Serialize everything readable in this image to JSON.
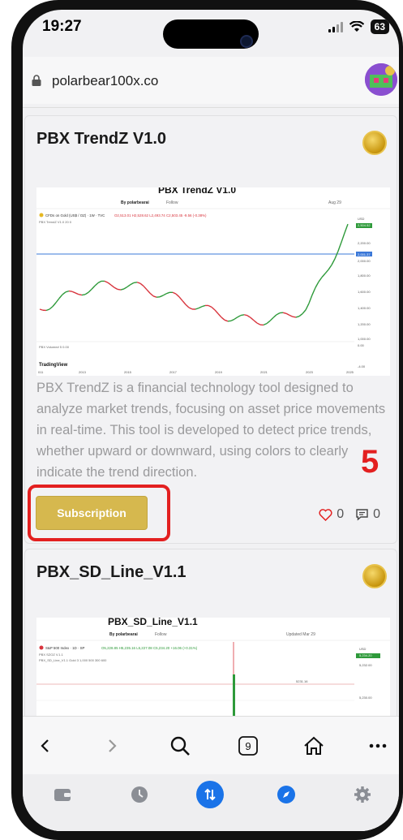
{
  "status_bar": {
    "time": "19:27",
    "battery": "63"
  },
  "browser": {
    "url": "polarbear100x.co",
    "tab_count": "9"
  },
  "cards": [
    {
      "title": "PBX TrendZ V1.0",
      "chart_title": "PBX TrendZ V1.0",
      "chart_byline": "By polarbearai",
      "chart_follow": "Follow",
      "chart_date": "Aug 29",
      "chart_symbol": "CFDs on Gold (US$ / OZ) · 1W · TVC",
      "chart_ohlc": "O2,513.01 H2,528.62 L2,493.74 C2,503.45 -9.56 (-0.38%)",
      "chart_indicator": "PBX TrendZ V1.0 20 0",
      "chart_volume": "PBX Volume# 5 0.00",
      "chart_brand": "TradingView",
      "chart_price_labels": [
        "USD",
        "2,504.52",
        "2,200.00",
        "2,001.37",
        "2,000.00",
        "1,800.00",
        "1,600.00",
        "1,400.00",
        "1,200.00",
        "1,000.00",
        "0.00",
        "-4.00"
      ],
      "chart_years": [
        "011",
        "2013",
        "2015",
        "2017",
        "2019",
        "2021",
        "2023",
        "2025"
      ],
      "description": "PBX TrendZ is a financial technology tool designed to analyze market trends, focusing on asset price movements in real-time. This tool is developed to detect price trends, whether upward or downward, using colors to clearly indicate the trend direction.",
      "button_label": "Subscription",
      "likes": "0",
      "comments": "0",
      "annotation_number": "5"
    },
    {
      "title": "PBX_SD_Line_V1.1",
      "chart_title": "PBX_SD_Line_V1.1",
      "chart_byline": "By polarbearai",
      "chart_follow": "Follow",
      "chart_date": "Updated Mar 29",
      "chart_symbol": "S&P 500 Index · 1D · SP",
      "chart_ohlc": "O5,228.85 H5,235.16 L5,227.08 C5,234.20 +16.06 (+0.31%)",
      "chart_indicator": "PBX SZOZ V.1.1",
      "chart_indicator2": "PBX_SD_Line_V1.1 Gold 3 1,000 500 300 600",
      "chart_price_labels": [
        "USD",
        "5,234.20",
        "5,232.00",
        "5231.16",
        "5,230.00",
        "5228.19",
        "5,228.00"
      ]
    }
  ],
  "colors": {
    "accent_gold": "#d6b84e",
    "annotation_red": "#e32020",
    "trend_green": "#2e9a3a",
    "trend_red": "#d8343d"
  },
  "nav_icons": [
    "back-icon",
    "forward-icon",
    "search-icon",
    "tabs-icon",
    "home-icon",
    "more-icon"
  ],
  "tab_icons": [
    "wallet-icon",
    "history-icon",
    "swap-icon",
    "explore-icon",
    "settings-icon"
  ]
}
